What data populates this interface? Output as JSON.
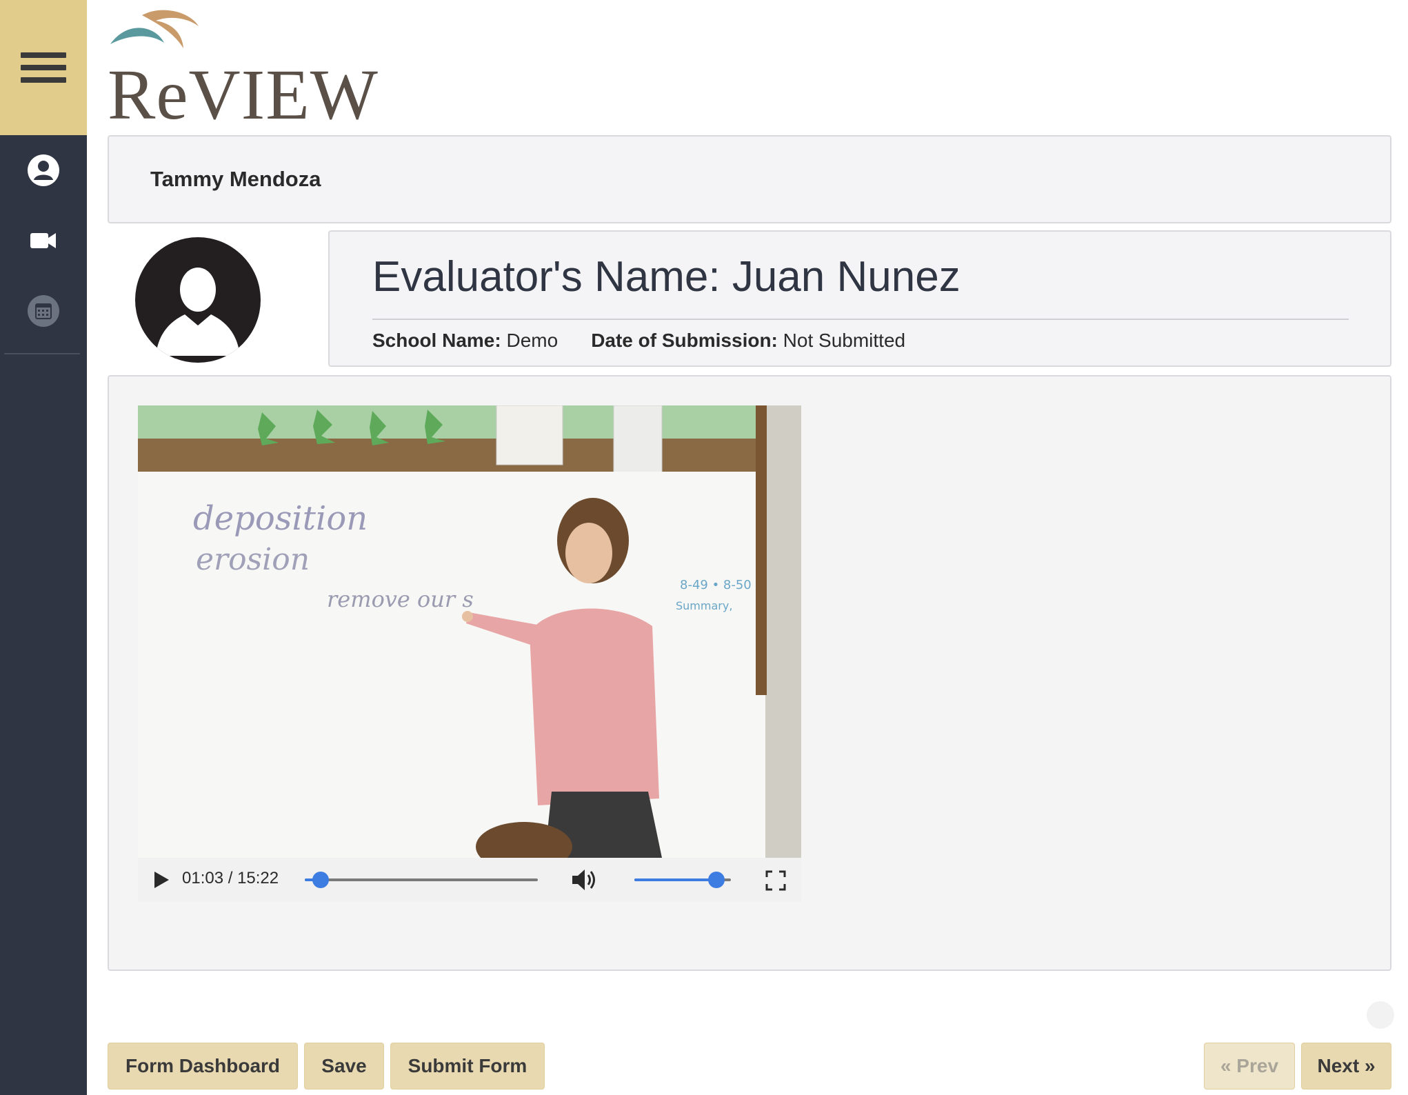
{
  "app": {
    "logo_text": "ReVIEW"
  },
  "sidebar": {
    "items": [
      {
        "name": "profile",
        "icon": "user-circle-icon"
      },
      {
        "name": "videos",
        "icon": "video-camera-icon"
      },
      {
        "name": "calendar",
        "icon": "calendar-icon"
      }
    ]
  },
  "header": {
    "teacher_name": "Tammy Mendoza"
  },
  "evaluation": {
    "title": "Evaluator's Name: Juan Nunez",
    "school_label": "School Name:",
    "school_value": "Demo",
    "date_label": "Date of Submission:",
    "date_value": "Not Submitted"
  },
  "video": {
    "time_display": "01:03 / 15:22",
    "progress_fraction": 0.069,
    "volume_fraction": 0.85
  },
  "buttons": {
    "dashboard": "Form Dashboard",
    "save": "Save",
    "submit": "Submit Form",
    "prev": "« Prev",
    "next": "Next »"
  },
  "colors": {
    "sidebar": "#2f3542",
    "menu_toggle": "#e1cc8c",
    "button": "#e8d9b0",
    "accent_blue": "#3d7ce0"
  }
}
